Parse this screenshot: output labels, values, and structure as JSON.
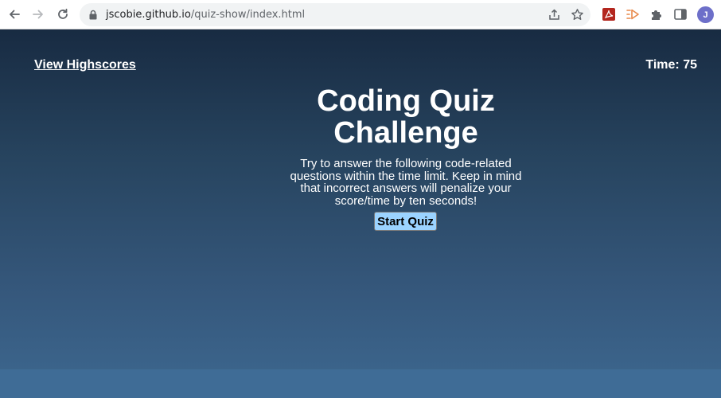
{
  "browser": {
    "url_host": "jscobie.github.io",
    "url_path": "/quiz-show/index.html",
    "avatar_letter": "J",
    "icons": [
      "back-icon",
      "forward-icon",
      "reload-icon",
      "lock-icon",
      "share-icon",
      "bookmark-star-icon",
      "pdf-extension-icon",
      "media-extension-icon",
      "extensions-puzzle-icon",
      "side-panel-icon"
    ]
  },
  "header": {
    "highscores_label": "View Highscores",
    "timer_label": "Time: 75"
  },
  "quiz": {
    "title": "Coding Quiz Challenge",
    "intro": "Try to answer the following code-related questions within the time limit. Keep in mind that incorrect answers will penalize your score/time by ten seconds!",
    "start_label": "Start Quiz"
  },
  "colors": {
    "page_top": "#182b42",
    "page_bottom": "#3d6890",
    "start_button": "#9bd3ff"
  }
}
